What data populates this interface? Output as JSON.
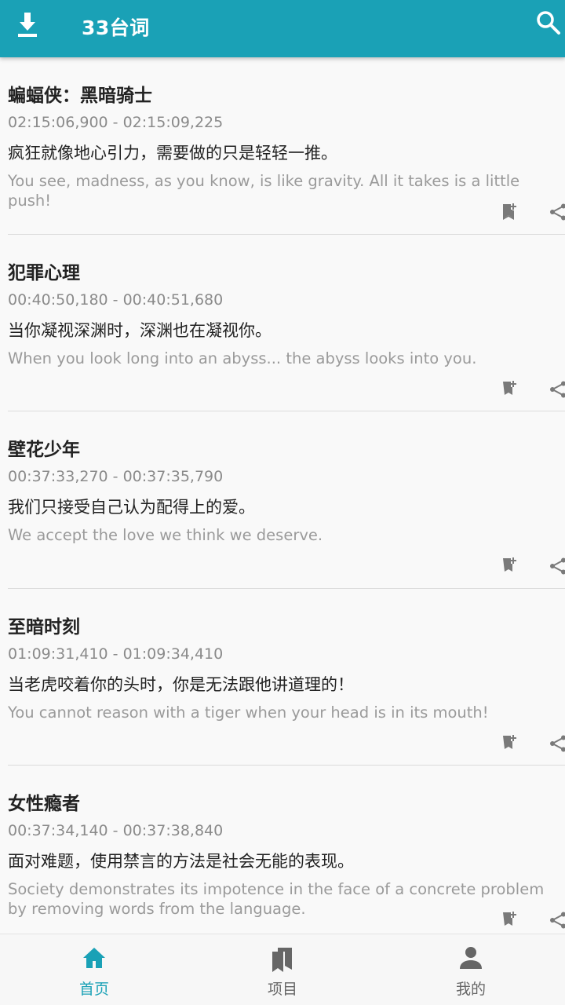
{
  "appbar": {
    "title": "33台词",
    "download_icon": "download-icon",
    "search_icon": "search-icon"
  },
  "colors": {
    "primary": "#1aa1b6",
    "icon_gray": "#777777"
  },
  "quotes": [
    {
      "movie": "蝙蝠侠：黑暗骑士",
      "time": "02:15:06,900 - 02:15:09,225",
      "zh": "疯狂就像地心引力，需要做的只是轻轻一推。",
      "en": "You see, madness, as you know, is like gravity. All it takes is a little push!"
    },
    {
      "movie": "犯罪心理",
      "time": "00:40:50,180 - 00:40:51,680",
      "zh": "当你凝视深渊时，深渊也在凝视你。",
      "en": "When you look long into an abyss... the abyss looks into you."
    },
    {
      "movie": "壁花少年",
      "time": "00:37:33,270 - 00:37:35,790",
      "zh": "我们只接受自己认为配得上的爱。",
      "en": "We accept the love we think we deserve."
    },
    {
      "movie": "至暗时刻",
      "time": "01:09:31,410 - 01:09:34,410",
      "zh": "当老虎咬着你的头时，你是无法跟他讲道理的！",
      "en": "You cannot reason with a tiger when your head is in its mouth!"
    },
    {
      "movie": "女性瘾者",
      "time": "00:37:34,140 - 00:37:38,840",
      "zh": "面对难题，使用禁言的方法是社会无能的表现。",
      "en": "Society demonstrates its impotence in the face of a concrete problem by removing words from the language."
    }
  ],
  "bottom_nav": [
    {
      "label": "首页",
      "icon": "home-icon",
      "active": true
    },
    {
      "label": "项目",
      "icon": "bookmarks-icon",
      "active": false
    },
    {
      "label": "我的",
      "icon": "person-icon",
      "active": false
    }
  ]
}
